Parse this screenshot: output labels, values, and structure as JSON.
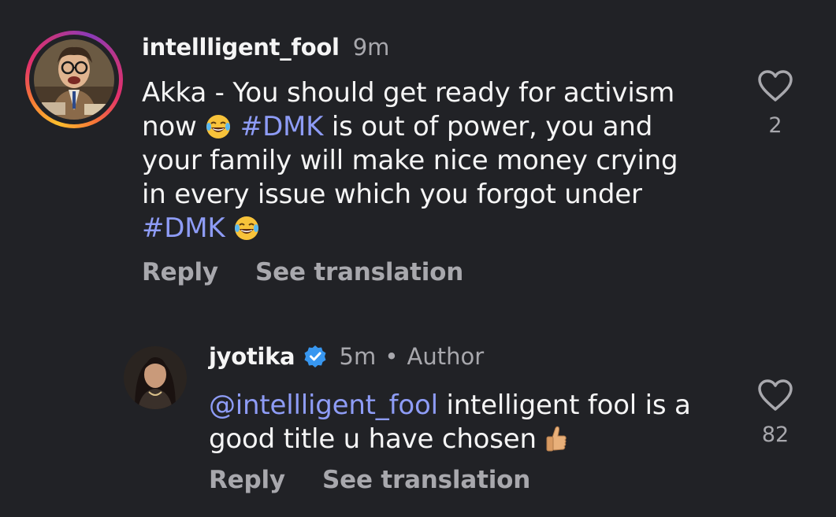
{
  "comment": {
    "username": "intellligent_fool",
    "time": "9m",
    "line1": "Akka - You should get ready for activism",
    "line2_a": "now",
    "line2_hashtag": "#DMK",
    "line2_b": " is out of power, you and",
    "line3": "your family will make nice money crying",
    "line4": "in every issue which you forgot under",
    "line5_hashtag": "#DMK",
    "emoji": "laughing-tears-emoji",
    "like_count": "2",
    "reply_label": "Reply",
    "translate_label": "See translation"
  },
  "reply": {
    "username": "jyotika",
    "time": "5m",
    "separator": "•",
    "role": "Author",
    "mention": "@intellligent_fool",
    "text_a": " intelligent fool is a",
    "text_b": "good title u have chosen",
    "emoji": "thumbs-up-emoji",
    "like_count": "82",
    "reply_label": "Reply",
    "translate_label": "See translation"
  },
  "colors": {
    "background": "#212226",
    "text": "#f5f5f5",
    "muted": "#a8a8ad",
    "link": "#8e9cf6",
    "verified": "#3897f0"
  }
}
